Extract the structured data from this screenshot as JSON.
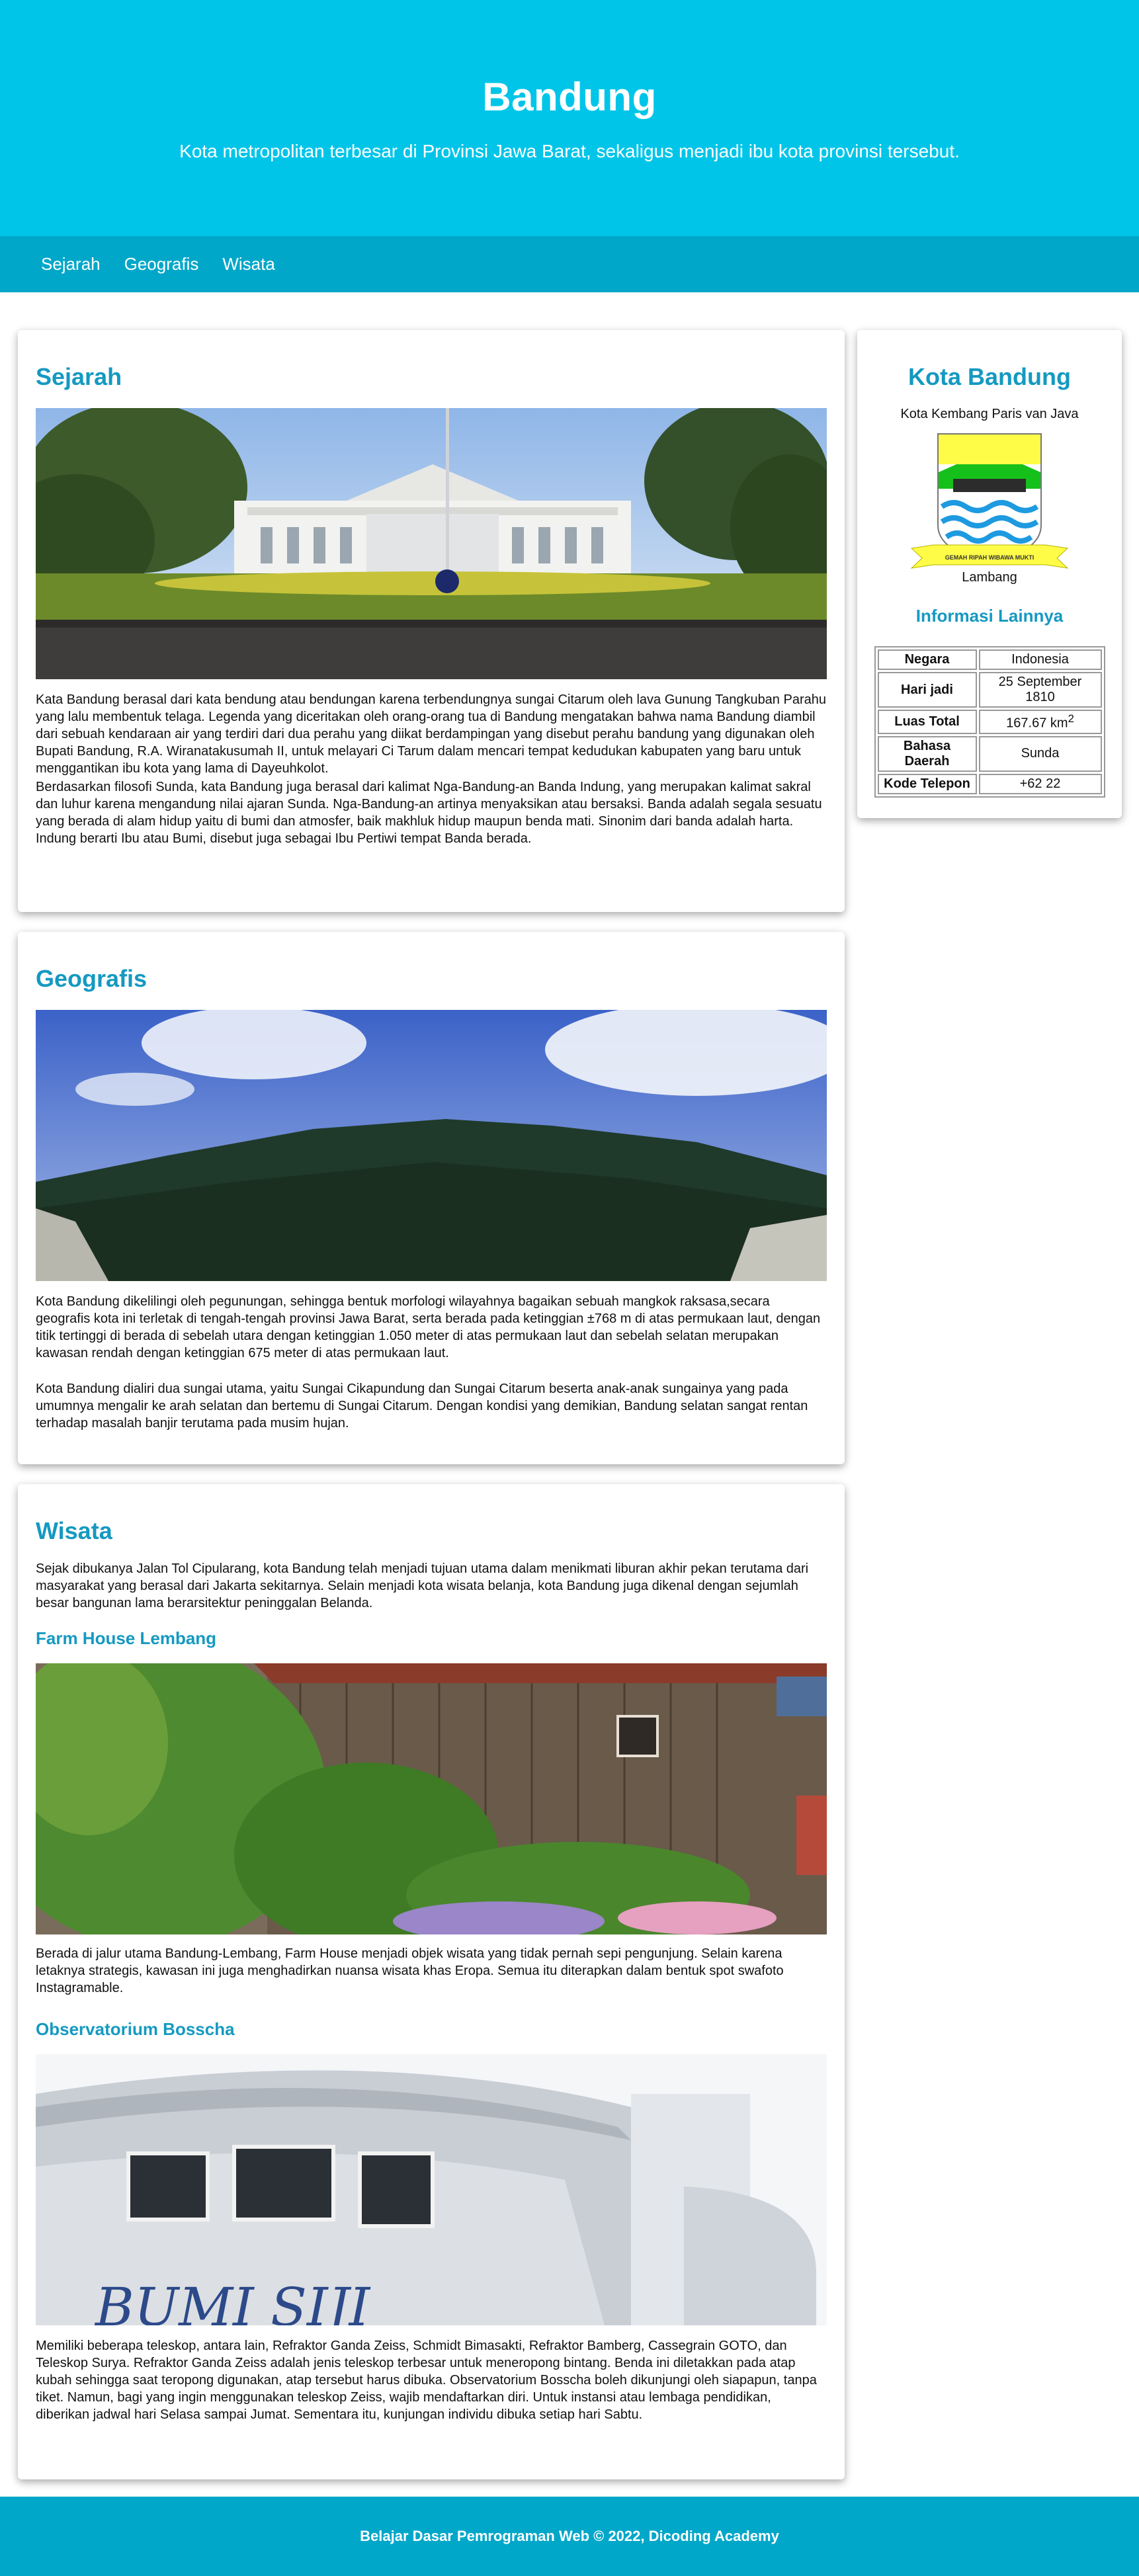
{
  "header": {
    "title": "Bandung",
    "subtitle": "Kota metropolitan terbesar di Provinsi Jawa Barat, sekaligus menjadi ibu kota provinsi tersebut."
  },
  "nav": {
    "items": [
      "Sejarah",
      "Geografis",
      "Wisata"
    ]
  },
  "sejarah": {
    "title": "Sejarah",
    "image": "gedung-sate-photo",
    "p1": "Kata Bandung berasal dari kata bendung atau bendungan karena terbendungnya sungai Citarum oleh lava Gunung Tangkuban Parahu yang lalu membentuk telaga. Legenda yang diceritakan oleh orang-orang tua di Bandung mengatakan bahwa nama Bandung diambil dari sebuah kendaraan air yang terdiri dari dua perahu yang diikat berdampingan yang disebut perahu bandung yang digunakan oleh Bupati Bandung, R.A. Wiranatakusumah II, untuk melayari Ci Tarum dalam mencari tempat kedudukan kabupaten yang baru untuk menggantikan ibu kota yang lama di Dayeuhkolot.",
    "p2": "Berdasarkan filosofi Sunda, kata Bandung juga berasal dari kalimat Nga-Bandung-an Banda Indung, yang merupakan kalimat sakral dan luhur karena mengandung nilai ajaran Sunda. Nga-Bandung-an artinya menyaksikan atau bersaksi. Banda adalah segala sesuatu yang berada di alam hidup yaitu di bumi dan atmosfer, baik makhluk hidup maupun benda mati. Sinonim dari banda adalah harta. Indung berarti Ibu atau Bumi, disebut juga sebagai Ibu Pertiwi tempat Banda berada."
  },
  "geografis": {
    "title": "Geografis",
    "image": "mountain-photo",
    "p1": "Kota Bandung dikelilingi oleh pegunungan, sehingga bentuk morfologi wilayahnya bagaikan sebuah mangkok raksasa,secara geografis kota ini terletak di tengah-tengah provinsi Jawa Barat, serta berada pada ketinggian ±768 m di atas permukaan laut, dengan titik tertinggi di berada di sebelah utara dengan ketinggian 1.050 meter di atas permukaan laut dan sebelah selatan merupakan kawasan rendah dengan ketinggian 675 meter di atas permukaan laut.",
    "p2": "Kota Bandung dialiri dua sungai utama, yaitu Sungai Cikapundung dan Sungai Citarum beserta anak-anak sungainya yang pada umumnya mengalir ke arah selatan dan bertemu di Sungai Citarum. Dengan kondisi yang demikian, Bandung selatan sangat rentan terhadap masalah banjir terutama pada musim hujan."
  },
  "wisata": {
    "title": "Wisata",
    "intro": "Sejak dibukanya Jalan Tol Cipularang, kota Bandung telah menjadi tujuan utama dalam menikmati liburan akhir pekan terutama dari masyarakat yang berasal dari Jakarta sekitarnya. Selain menjadi kota wisata belanja, kota Bandung juga dikenal dengan sejumlah besar bangunan lama berarsitektur peninggalan Belanda.",
    "places": [
      {
        "name": "Farm House Lembang",
        "image": "farmhouse-photo",
        "desc": "Berada di jalur utama Bandung-Lembang, Farm House menjadi objek wisata yang tidak pernah sepi pengunjung. Selain karena letaknya strategis, kawasan ini juga menghadirkan nuansa wisata khas Eropa. Semua itu diterapkan dalam bentuk spot swafoto Instagramable."
      },
      {
        "name": "Observatorium Bosscha",
        "image": "bosscha-photo",
        "desc": "Memiliki beberapa teleskop, antara lain, Refraktor Ganda Zeiss, Schmidt Bimasakti, Refraktor Bamberg, Cassegrain GOTO, dan Teleskop Surya. Refraktor Ganda Zeiss adalah jenis teleskop terbesar untuk meneropong bintang. Benda ini diletakkan pada atap kubah sehingga saat teropong digunakan, atap tersebut harus dibuka. Observatorium Bosscha boleh dikunjungi oleh siapapun, tanpa tiket. Namun, bagi yang ingin menggunakan teleskop Zeiss, wajib mendaftarkan diri. Untuk instansi atau lembaga pendidikan, diberikan jadwal hari Selasa sampai Jumat. Sementara itu, kunjungan individu dibuka setiap hari Sabtu."
      }
    ]
  },
  "aside": {
    "title": "Kota Bandung",
    "tagline": "Kota Kembang Paris van Java",
    "emblem_motto": "GEMAH RIPAH WIBAWA MUKTI",
    "emblem_caption": "Lambang",
    "info_title": "Informasi Lainnya",
    "rows": [
      {
        "key": "Negara",
        "value": "Indonesia"
      },
      {
        "key": "Hari jadi",
        "value": "25 September 1810"
      },
      {
        "key": "Luas Total",
        "value": "167.67 km",
        "sup": "2"
      },
      {
        "key": "Bahasa Daerah",
        "value": "Sunda"
      },
      {
        "key": "Kode Telepon",
        "value": "+62 22"
      }
    ]
  },
  "footer": {
    "text": "Belajar Dasar Pemrograman Web © 2022, Dicoding Academy"
  },
  "colors": {
    "hero": "#00c5e8",
    "nav": "#00a7c9",
    "accent": "#1599c1"
  }
}
